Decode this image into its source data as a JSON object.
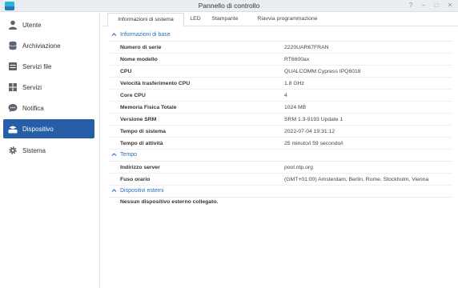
{
  "window": {
    "title": "Pannello di controllo"
  },
  "sidebar": {
    "items": [
      {
        "label": "Utente",
        "icon": "user-icon"
      },
      {
        "label": "Archiviazione",
        "icon": "storage-icon"
      },
      {
        "label": "Servizi file",
        "icon": "file-services-icon"
      },
      {
        "label": "Servizi",
        "icon": "services-icon"
      },
      {
        "label": "Notifica",
        "icon": "notification-icon"
      },
      {
        "label": "Dispositivo",
        "icon": "router-icon",
        "active": true
      },
      {
        "label": "Sistema",
        "icon": "gear-icon"
      }
    ]
  },
  "tabs": [
    "Informazioni di sistema",
    "LED",
    "Stampante",
    "Riavvia programmazione"
  ],
  "sections": {
    "base": {
      "title": "Informazioni di base",
      "rows": [
        {
          "label": "Numero di serie",
          "value": "2220UAR67FRAN"
        },
        {
          "label": "Nome modello",
          "value": "RT6600ax"
        },
        {
          "label": "CPU",
          "value": "QUALCOMM Cypress IPQ6018"
        },
        {
          "label": "Velocità trasferimento CPU",
          "value": "1.8 GHz"
        },
        {
          "label": "Core CPU",
          "value": "4"
        },
        {
          "label": "Memoria Fisica Totale",
          "value": "1024 MB"
        },
        {
          "label": "Versione SRM",
          "value": "SRM 1.3-9193 Update 1"
        },
        {
          "label": "Tempo di sistema",
          "value": "2022-07-04 19:31:12"
        },
        {
          "label": "Tempo di attività",
          "value": "25 minuto/i 59 secondo/i"
        }
      ]
    },
    "tempo": {
      "title": "Tempo",
      "rows": [
        {
          "label": "Indirizzo server",
          "value": "pool.ntp.org"
        },
        {
          "label": "Fuso orario",
          "value": "(GMT+01:00) Amsterdam, Berlin, Rome, Stockholm, Vienna"
        }
      ]
    },
    "external": {
      "title": "Dispositivi esterni",
      "note": "Nessun dispositivo esterno collegato."
    }
  },
  "colors": {
    "accent": "#275ea8",
    "section_title": "#2b6fb6",
    "titlebar": "#e9eef3"
  }
}
